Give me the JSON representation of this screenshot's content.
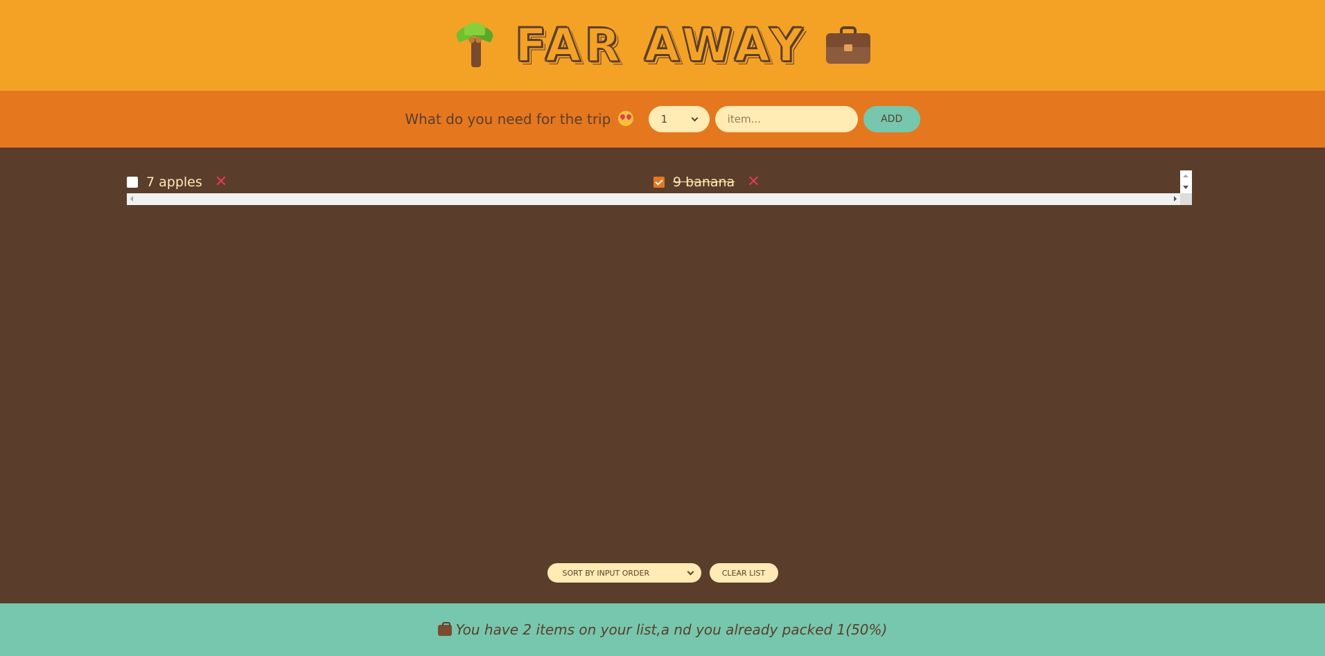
{
  "header": {
    "title": "FAR AWAY",
    "left_icon": "palm-tree-icon",
    "right_icon": "briefcase-icon"
  },
  "form": {
    "question": "What do you need for the trip",
    "emoji": "heart-eyes-emoji-icon",
    "quantity_selected": "1",
    "item_placeholder": "item...",
    "add_label": "ADD"
  },
  "list": {
    "items": [
      {
        "quantity": 7,
        "text": "7 apples",
        "packed": false
      },
      {
        "quantity": 9,
        "text": "9 banana",
        "packed": true
      }
    ],
    "remove_glyph": "✕"
  },
  "actions": {
    "sort_selected": "SORT BY INPUT ORDER",
    "clear_label": "CLEAR LIST"
  },
  "stats": {
    "text": "You have 2 items on your list,a nd you already packed 1(50%)",
    "total_items": 2,
    "packed_items": 1,
    "packed_percent": 50
  },
  "colors": {
    "header": "#f4a226",
    "form": "#e5771f",
    "list": "#5a3e2b",
    "stats": "#76c7ad",
    "input": "#ffebb3",
    "remove": "#e23b55"
  }
}
